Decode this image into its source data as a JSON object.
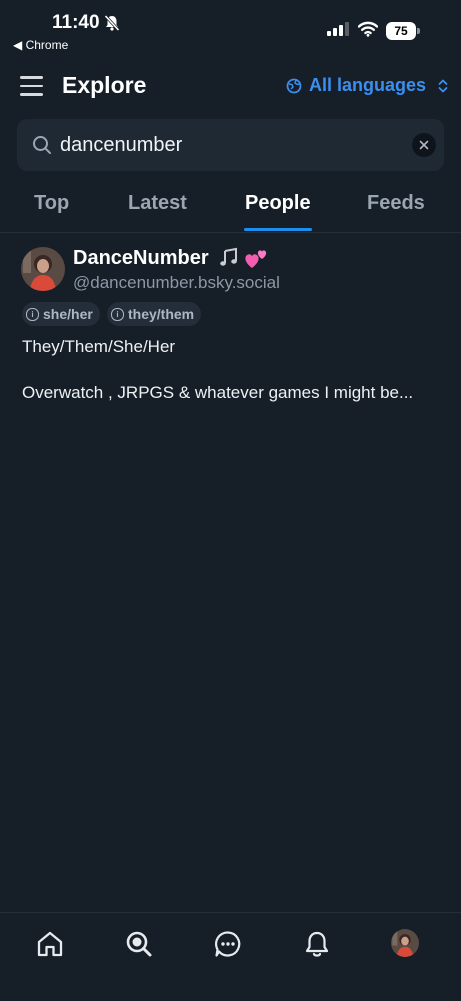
{
  "status_bar": {
    "time": "11:40",
    "back_app": "◀ Chrome",
    "battery": "75"
  },
  "header": {
    "title": "Explore",
    "language_filter": "All languages",
    "accent_color": "#3b8ff0"
  },
  "search": {
    "value": "dancenumber"
  },
  "tabs": [
    {
      "label": "Top",
      "active": false
    },
    {
      "label": "Latest",
      "active": false
    },
    {
      "label": "People",
      "active": true
    },
    {
      "label": "Feeds",
      "active": false
    }
  ],
  "results": [
    {
      "display_name": "DanceNumber",
      "name_emojis": [
        "musical-notes-icon",
        "two-hearts-icon"
      ],
      "handle": "@dancenumber.bsky.social",
      "pronouns": [
        "she/her",
        "they/them"
      ],
      "bio_line_1": "They/Them/She/Her",
      "bio_line_2": "Overwatch , JRPGS & whatever games I might be..."
    }
  ],
  "bottom_nav": [
    {
      "icon": "home-icon"
    },
    {
      "icon": "search-icon"
    },
    {
      "icon": "chat-icon"
    },
    {
      "icon": "notifications-icon"
    },
    {
      "icon": "profile-avatar"
    }
  ]
}
